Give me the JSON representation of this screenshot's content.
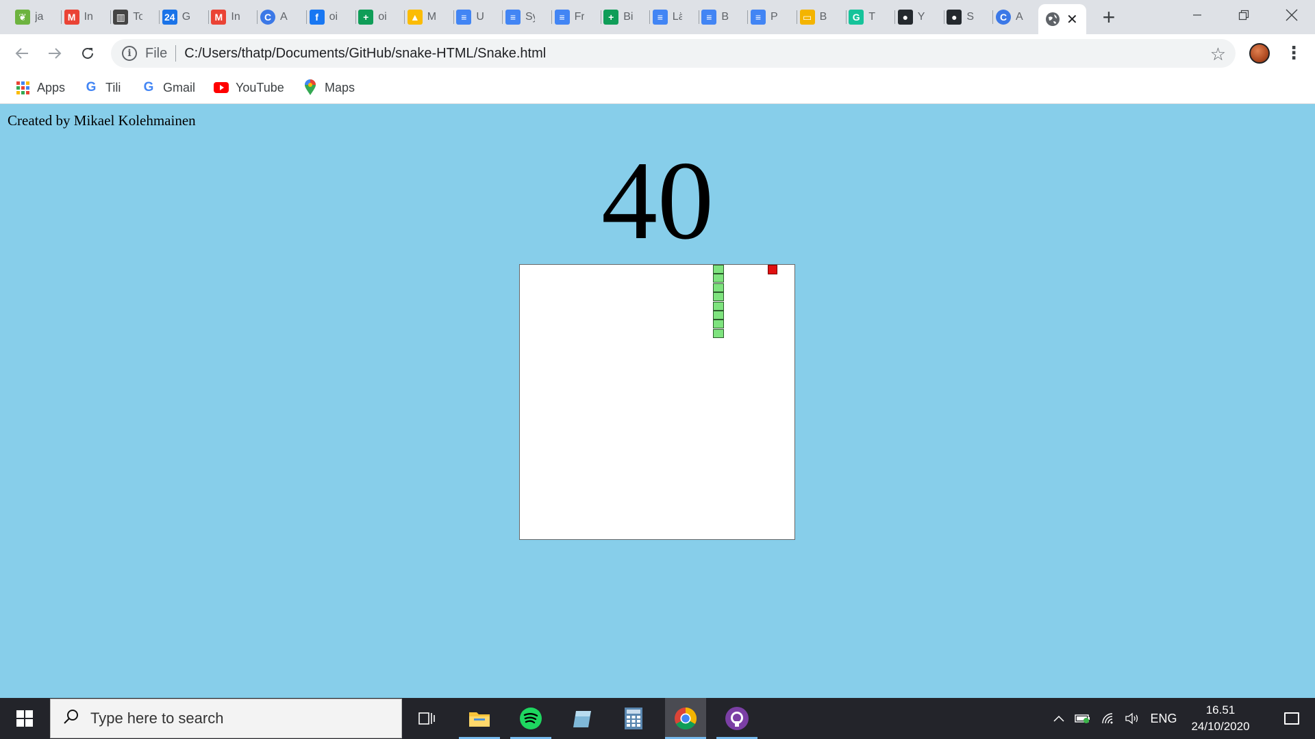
{
  "browser": {
    "tabs": [
      {
        "title": "ja",
        "icon": "leaf-icon",
        "color": "#6db33f"
      },
      {
        "title": "In",
        "icon": "gmail-icon",
        "color": "#ea4335"
      },
      {
        "title": "To",
        "icon": "trello-icon",
        "color": "#444444"
      },
      {
        "title": "G",
        "icon": "calendar-icon",
        "color": "#1a73e8"
      },
      {
        "title": "In",
        "icon": "gmail-icon",
        "color": "#ea4335"
      },
      {
        "title": "A",
        "icon": "c-icon",
        "color": "#3b78e7"
      },
      {
        "title": "oi",
        "icon": "facebook-icon",
        "color": "#1877f2"
      },
      {
        "title": "oi",
        "icon": "sheets-icon",
        "color": "#0f9d58"
      },
      {
        "title": "M",
        "icon": "drive-icon",
        "color": "#fbbc04"
      },
      {
        "title": "U",
        "icon": "docs-icon",
        "color": "#4285f4"
      },
      {
        "title": "Sy",
        "icon": "docs-icon",
        "color": "#4285f4"
      },
      {
        "title": "Fr",
        "icon": "docs-icon",
        "color": "#4285f4"
      },
      {
        "title": "Bi",
        "icon": "sheets-icon",
        "color": "#0f9d58"
      },
      {
        "title": "Lä",
        "icon": "docs-icon",
        "color": "#4285f4"
      },
      {
        "title": "B",
        "icon": "docs-icon",
        "color": "#4285f4"
      },
      {
        "title": "P",
        "icon": "docs-icon",
        "color": "#4285f4"
      },
      {
        "title": "B",
        "icon": "slides-icon",
        "color": "#f4b400"
      },
      {
        "title": "T",
        "icon": "grammarly-icon",
        "color": "#15c39a"
      },
      {
        "title": "Y",
        "icon": "github-icon",
        "color": "#24292e"
      },
      {
        "title": "S",
        "icon": "github-icon",
        "color": "#24292e"
      },
      {
        "title": "A",
        "icon": "c-icon",
        "color": "#3b78e7"
      }
    ],
    "active_tab_icon": "globe-icon",
    "address": {
      "scheme_label": "File",
      "url": "C:/Users/thatp/Documents/GitHub/snake-HTML/Snake.html"
    },
    "bookmarks": [
      {
        "label": "Apps",
        "icon": "apps-grid-icon"
      },
      {
        "label": "Tili",
        "icon": "google-icon"
      },
      {
        "label": "Gmail",
        "icon": "google-icon"
      },
      {
        "label": "YouTube",
        "icon": "youtube-icon"
      },
      {
        "label": "Maps",
        "icon": "maps-pin-icon"
      }
    ]
  },
  "page": {
    "credit": "Created by Mikael Kolehmainen",
    "score": "40",
    "board_bg": "#ffffff",
    "page_bg": "#87ceea",
    "snake_color": "#7ee37e",
    "food_color": "#e01010"
  },
  "taskbar": {
    "search_placeholder": "Type here to search",
    "language": "ENG",
    "time": "16.51",
    "date": "24/10/2020"
  }
}
